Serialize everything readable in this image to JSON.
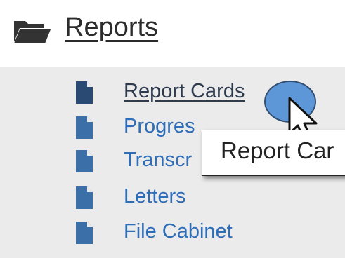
{
  "header": {
    "title": "Reports",
    "icon": "folder-open-icon"
  },
  "menu": {
    "items": [
      {
        "label": "Report Cards",
        "icon": "document-icon"
      },
      {
        "label": "Progres",
        "icon": "document-icon"
      },
      {
        "label": "Transcr",
        "icon": "document-icon"
      },
      {
        "label": "Letters",
        "icon": "document-icon"
      },
      {
        "label": "File Cabinet",
        "icon": "document-icon"
      }
    ]
  },
  "tooltip": {
    "text": "Report Car"
  },
  "colors": {
    "link": "#2f6db6",
    "active": "#2e3b4e",
    "icon": "#3b6fa8",
    "menu_bg": "#ebebeb"
  }
}
